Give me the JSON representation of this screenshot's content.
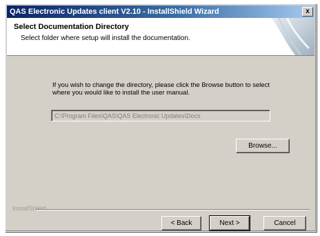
{
  "window": {
    "title": "QAS Electronic Updates client V2.10 - InstallShield Wizard",
    "close_symbol": "x"
  },
  "header": {
    "title": "Select Documentation Directory",
    "subtitle": "Select folder where setup will install the documentation."
  },
  "main": {
    "instructions": "If you wish to change the directory, please click the Browse button to select where you would like to install the user manual.",
    "path_value": "C:\\Program Files\\QAS\\QAS Electronic Updates\\Docs",
    "browse_label": "Browse..."
  },
  "footer": {
    "brand": "InstallShield",
    "back_label": "< Back",
    "next_label": "Next >",
    "cancel_label": "Cancel"
  },
  "colors": {
    "title_gradient_start": "#0a246a",
    "title_gradient_end": "#a6caf0",
    "dialog_face": "#d4d0c8"
  }
}
